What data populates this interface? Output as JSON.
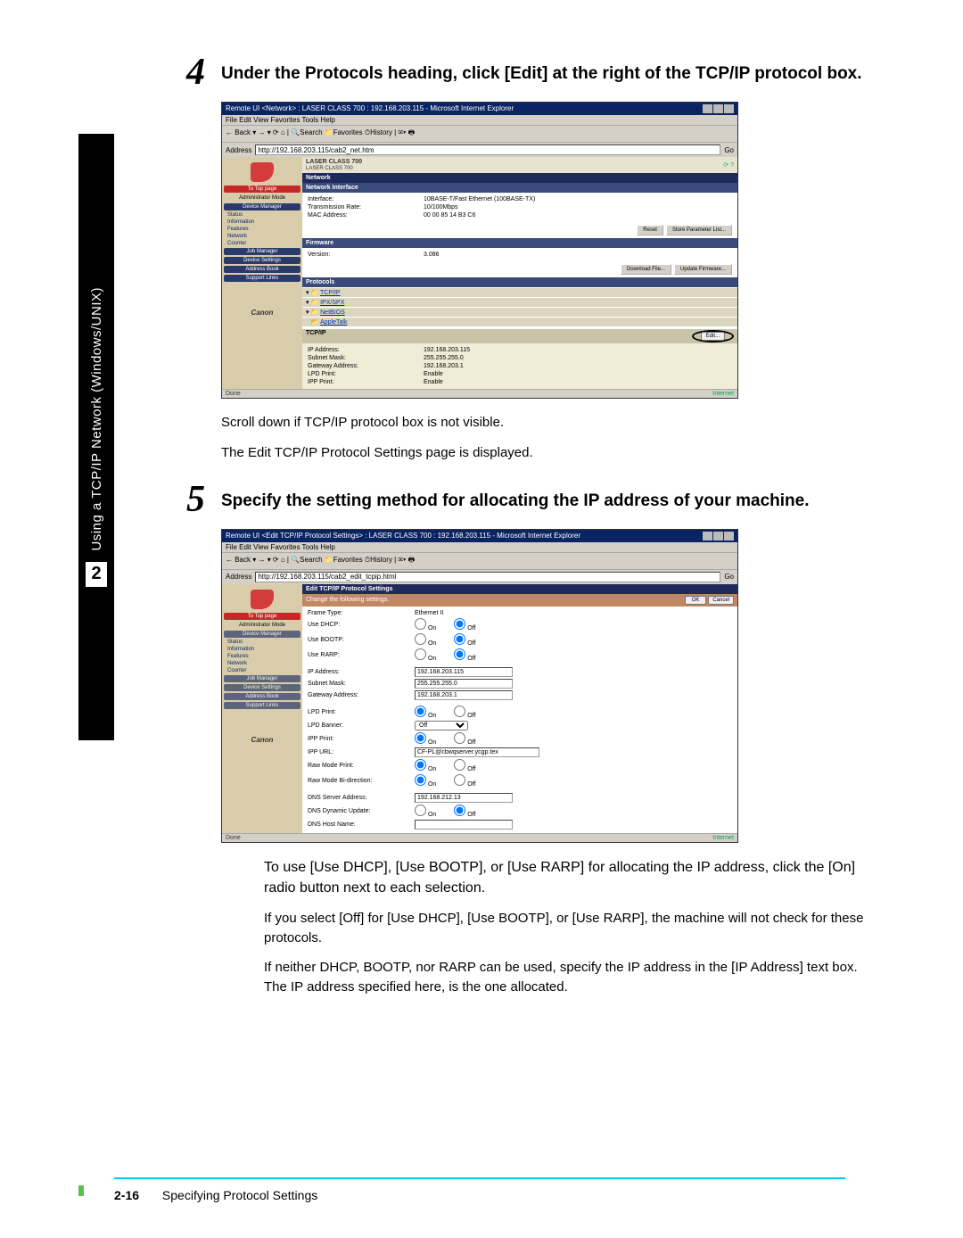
{
  "sidebar": {
    "label": "Using a TCP/IP Network (Windows/UNIX)",
    "chapter": "2"
  },
  "step4": {
    "num": "4",
    "heading": "Under the Protocols heading, click [Edit] at the right of the TCP/IP protocol box.",
    "shot": {
      "title": "Remote UI <Network> : LASER CLASS 700 : 192.168.203.115 - Microsoft Internet Explorer",
      "menu": "File  Edit  View  Favorites  Tools  Help",
      "toolbar": "← Back ▾ → ▾ ⟳ ⌂ | 🔍Search 📁Favorites ⏱History | ✉▾ 🖶",
      "addr_label": "Address",
      "addr": "http://192.168.203.115/cab2_net.htm",
      "go": "Go",
      "dev_line1": "LASER CLASS 700",
      "dev_line2": "LASER CLASS 700",
      "band_network": "Network",
      "band_iface": "Network Interface",
      "iface": {
        "k1": "Interface:",
        "v1": "10BASE-T/Fast Ethernet (100BASE-TX)",
        "k2": "Transmission Rate:",
        "v2": "10/100Mbps",
        "k3": "MAC Address:",
        "v3": "00 00 85 14 B3 C6"
      },
      "btn_reset": "Reset",
      "btn_store": "Store Parameter List...",
      "band_fw": "Firmware",
      "fw_k": "Version:",
      "fw_v": "3.086",
      "btn_dl": "Download File...",
      "btn_upd": "Update Firmware...",
      "band_proto": "Protocols",
      "protos": {
        "p1": "TCP/IP",
        "p2": "IPX/SPX",
        "p3": "NetBIOS",
        "p4": "AppleTalk"
      },
      "tcp_head": "TCP/IP",
      "tcp": {
        "k1": "IP Address:",
        "v1": "192.168.203.115",
        "k2": "Subnet Mask:",
        "v2": "255.255.255.0",
        "k3": "Gateway Address:",
        "v3": "192.168.203.1",
        "k4": "LPD Print:",
        "v4": "Enable",
        "k5": "IPP Print:",
        "v5": "Enable"
      },
      "btn_edit": "Edit...",
      "status_l": "Done",
      "status_r": "Internet",
      "nav": {
        "top": "To Top page",
        "mode": "Administrator Mode",
        "b1": "Device Manager",
        "l1": "Status",
        "l2": "Information",
        "l3": "Features",
        "l4": "Network",
        "l5": "Counter",
        "b2": "Job Manager",
        "b3": "Device Settings",
        "b4": "Address Book",
        "b5": "Support Links",
        "brand": "Canon"
      }
    },
    "after1": "Scroll down if TCP/IP protocol box is not visible.",
    "after2": "The Edit TCP/IP Protocol Settings page is displayed."
  },
  "step5": {
    "num": "5",
    "heading": "Specify the setting method for allocating the IP address of your machine.",
    "shot": {
      "title": "Remote UI <Edit TCP/IP Protocol Settings> : LASER CLASS 700 : 192.168.203.115 - Microsoft Internet Explorer",
      "menu": "File  Edit  View  Favorites  Tools  Help",
      "toolbar": "← Back ▾ → ▾ ⟳ ⌂ | 🔍Search 📁Favorites ⏱History | ✉▾ 🖶",
      "addr_label": "Address",
      "addr": "http://192.168.203.115/cab2_edit_tcpip.html",
      "go": "Go",
      "hd": "Edit TCP/IP Protocol Settings",
      "sub": "Change the following settings.",
      "ok": "OK",
      "cancel": "Cancel",
      "rows": {
        "frame": "Frame Type:",
        "frame_v": "Ethernet II",
        "dhcp": "Use DHCP:",
        "bootp": "Use BOOTP:",
        "rarp": "Use RARP:",
        "on": "On",
        "off": "Off",
        "ip": "IP Address:",
        "ip_v": "192.168.203.115",
        "mask": "Subnet Mask:",
        "mask_v": "255.255.255.0",
        "gw": "Gateway Address:",
        "gw_v": "192.168.203.1",
        "lpd": "LPD Print:",
        "ban": "LPD Banner:",
        "ban_v": "Off",
        "ipp": "IPP Print:",
        "ippurl": "IPP URL:",
        "ippurl_v": "CF-PL@cbwqserver.ycgp.tex",
        "raw": "Raw Mode Print:",
        "rawbi": "Raw Mode Bi-direction:",
        "dns": "DNS Server Address:",
        "dns_v": "192.168.212.13",
        "ddns": "DNS Dynamic Update:",
        "host": "DNS Host Name:"
      },
      "nav": {
        "top": "To Top page",
        "mode": "Administrator Mode",
        "b1": "Device Manager",
        "l1": "Status",
        "l2": "Information",
        "l3": "Features",
        "l4": "Network",
        "l5": "Counter",
        "b2": "Job Manager",
        "b3": "Device Settings",
        "b4": "Address Book",
        "b5": "Support Links",
        "brand": "Canon"
      },
      "status_l": "Done",
      "status_r": "Internet"
    },
    "para1": "To use [Use DHCP], [Use BOOTP], or [Use RARP] for allocating the IP address, click the [On] radio button next to each selection.",
    "para2": "If you select [Off] for [Use DHCP], [Use BOOTP], or [Use RARP], the machine will not check for these protocols.",
    "para3": "If neither DHCP, BOOTP, nor RARP can be used, specify the IP address in the [IP Address] text box. The IP address specified here, is the one allocated."
  },
  "footer": {
    "page": "2-16",
    "title": "Specifying Protocol Settings"
  }
}
